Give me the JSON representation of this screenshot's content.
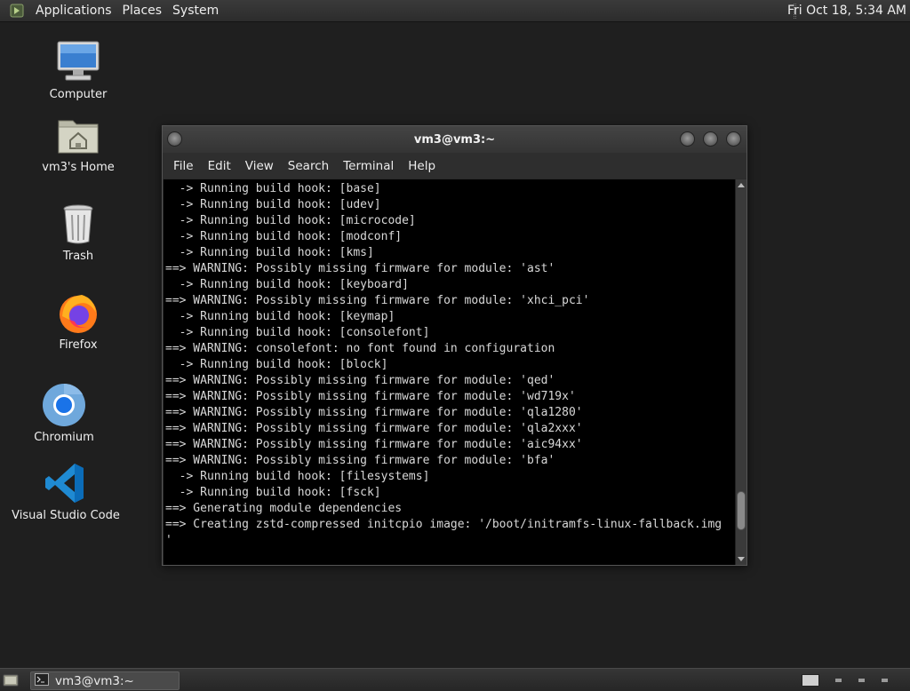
{
  "top_panel": {
    "menus": [
      "Applications",
      "Places",
      "System"
    ],
    "clock": "Fri Oct 18,  5:34 AM"
  },
  "desktop": {
    "icons": [
      {
        "label": "Computer",
        "icon": "computer-icon"
      },
      {
        "label": "vm3's Home",
        "icon": "home-folder-icon"
      },
      {
        "label": "Trash",
        "icon": "trash-icon"
      },
      {
        "label": "Firefox",
        "icon": "firefox-icon"
      },
      {
        "label": "Chromium",
        "icon": "chromium-icon"
      },
      {
        "label": "Visual Studio Code",
        "icon": "vscode-icon"
      }
    ]
  },
  "terminal": {
    "title": "vm3@vm3:~",
    "menu": [
      "File",
      "Edit",
      "View",
      "Search",
      "Terminal",
      "Help"
    ],
    "scroll_position": 0.93,
    "lines": [
      "  -> Running build hook: [base]",
      "  -> Running build hook: [udev]",
      "  -> Running build hook: [microcode]",
      "  -> Running build hook: [modconf]",
      "  -> Running build hook: [kms]",
      "==> WARNING: Possibly missing firmware for module: 'ast'",
      "  -> Running build hook: [keyboard]",
      "==> WARNING: Possibly missing firmware for module: 'xhci_pci'",
      "  -> Running build hook: [keymap]",
      "  -> Running build hook: [consolefont]",
      "==> WARNING: consolefont: no font found in configuration",
      "  -> Running build hook: [block]",
      "==> WARNING: Possibly missing firmware for module: 'qed'",
      "==> WARNING: Possibly missing firmware for module: 'wd719x'",
      "==> WARNING: Possibly missing firmware for module: 'qla1280'",
      "==> WARNING: Possibly missing firmware for module: 'qla2xxx'",
      "==> WARNING: Possibly missing firmware for module: 'aic94xx'",
      "==> WARNING: Possibly missing firmware for module: 'bfa'",
      "  -> Running build hook: [filesystems]",
      "  -> Running build hook: [fsck]",
      "==> Generating module dependencies",
      "==> Creating zstd-compressed initcpio image: '/boot/initramfs-linux-fallback.img",
      "'"
    ]
  },
  "taskbar": {
    "task_label": "vm3@vm3:~"
  },
  "colors": {
    "desktop_bg": "#1f1f1f",
    "terminal_bg": "#000000",
    "terminal_fg": "#d8d8d8"
  }
}
